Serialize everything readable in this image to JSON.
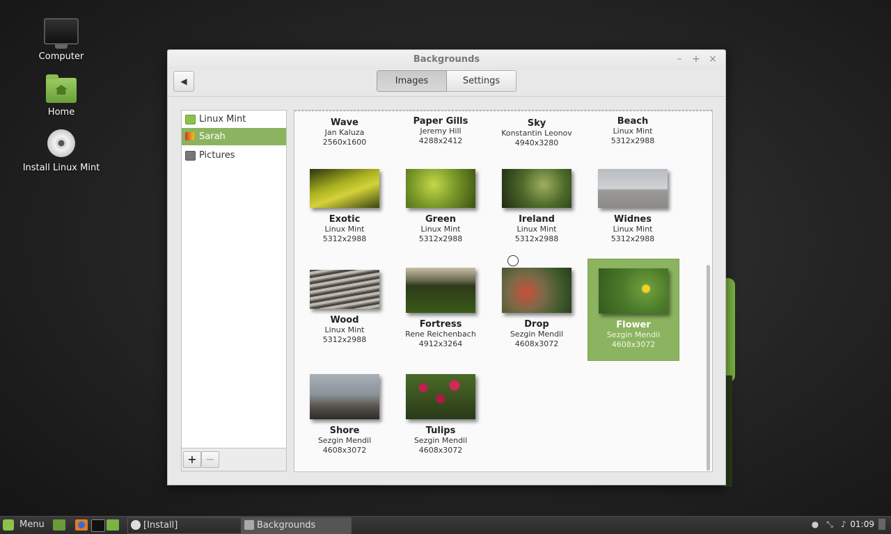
{
  "desktop": {
    "icons": [
      {
        "label": "Computer",
        "icon": "computer-icon"
      },
      {
        "label": "Home",
        "icon": "home-folder-icon"
      },
      {
        "label": "Install Linux Mint",
        "icon": "disc-icon"
      }
    ]
  },
  "window": {
    "title": "Backgrounds",
    "controls": {
      "minimize": "–",
      "maximize": "+",
      "close": "×"
    },
    "back_button": "◀",
    "tabs": [
      {
        "label": "Images",
        "active": true
      },
      {
        "label": "Settings",
        "active": false
      }
    ]
  },
  "sidebar": {
    "items": [
      {
        "label": "Linux Mint",
        "selected": false,
        "icon": "mint-icon"
      },
      {
        "label": "Sarah",
        "selected": true,
        "icon": "image-folder-icon"
      },
      {
        "label": "Pictures",
        "selected": false,
        "icon": "pictures-icon"
      }
    ],
    "add_label": "+",
    "remove_label": "−"
  },
  "backgrounds": [
    {
      "name": "Wave",
      "author": "Jan Kaluza",
      "resolution": "2560x1600",
      "selected": false
    },
    {
      "name": "Paper Gills",
      "author": "Jeremy Hill",
      "resolution": "4288x2412",
      "selected": false
    },
    {
      "name": "Sky",
      "author": "Konstantin Leonov",
      "resolution": "4940x3280",
      "selected": false
    },
    {
      "name": "Beach",
      "author": "Linux Mint",
      "resolution": "5312x2988",
      "selected": false
    },
    {
      "name": "Exotic",
      "author": "Linux Mint",
      "resolution": "5312x2988",
      "selected": false
    },
    {
      "name": "Green",
      "author": "Linux Mint",
      "resolution": "5312x2988",
      "selected": false
    },
    {
      "name": "Ireland",
      "author": "Linux Mint",
      "resolution": "5312x2988",
      "selected": false
    },
    {
      "name": "Widnes",
      "author": "Linux Mint",
      "resolution": "5312x2988",
      "selected": false
    },
    {
      "name": "Wood",
      "author": "Linux Mint",
      "resolution": "5312x2988",
      "selected": false
    },
    {
      "name": "Fortress",
      "author": "Rene Reichenbach",
      "resolution": "4912x3264",
      "selected": false
    },
    {
      "name": "Drop",
      "author": "Sezgin Mendil",
      "resolution": "4608x3072",
      "selected": false
    },
    {
      "name": "Flower",
      "author": "Sezgin Mendil",
      "resolution": "4608x3072",
      "selected": true
    },
    {
      "name": "Shore",
      "author": "Sezgin Mendil",
      "resolution": "4608x3072",
      "selected": false
    },
    {
      "name": "Tulips",
      "author": "Sezgin Mendil",
      "resolution": "4608x3072",
      "selected": false
    }
  ],
  "taskbar": {
    "menu_label": "Menu",
    "tasks": [
      {
        "label": "[Install]",
        "active": false
      },
      {
        "label": "Backgrounds",
        "active": true
      }
    ],
    "clock": "01:09"
  },
  "colors": {
    "accent": "#8cb35f",
    "mint_green": "#8bc34a"
  }
}
